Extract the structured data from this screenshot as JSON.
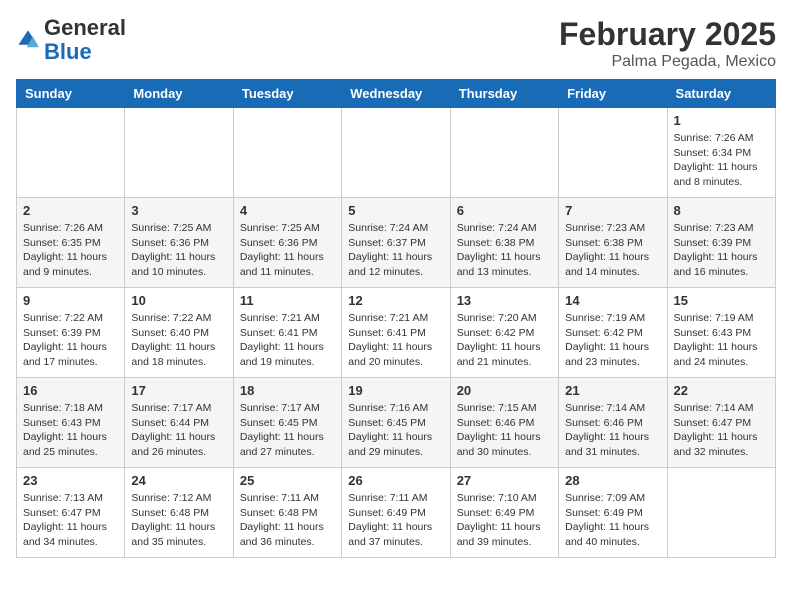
{
  "header": {
    "logo_general": "General",
    "logo_blue": "Blue",
    "month_title": "February 2025",
    "location": "Palma Pegada, Mexico"
  },
  "weekdays": [
    "Sunday",
    "Monday",
    "Tuesday",
    "Wednesday",
    "Thursday",
    "Friday",
    "Saturday"
  ],
  "weeks": [
    [
      {
        "day": "",
        "content": ""
      },
      {
        "day": "",
        "content": ""
      },
      {
        "day": "",
        "content": ""
      },
      {
        "day": "",
        "content": ""
      },
      {
        "day": "",
        "content": ""
      },
      {
        "day": "",
        "content": ""
      },
      {
        "day": "1",
        "content": "Sunrise: 7:26 AM\nSunset: 6:34 PM\nDaylight: 11 hours and 8 minutes."
      }
    ],
    [
      {
        "day": "2",
        "content": "Sunrise: 7:26 AM\nSunset: 6:35 PM\nDaylight: 11 hours and 9 minutes."
      },
      {
        "day": "3",
        "content": "Sunrise: 7:25 AM\nSunset: 6:36 PM\nDaylight: 11 hours and 10 minutes."
      },
      {
        "day": "4",
        "content": "Sunrise: 7:25 AM\nSunset: 6:36 PM\nDaylight: 11 hours and 11 minutes."
      },
      {
        "day": "5",
        "content": "Sunrise: 7:24 AM\nSunset: 6:37 PM\nDaylight: 11 hours and 12 minutes."
      },
      {
        "day": "6",
        "content": "Sunrise: 7:24 AM\nSunset: 6:38 PM\nDaylight: 11 hours and 13 minutes."
      },
      {
        "day": "7",
        "content": "Sunrise: 7:23 AM\nSunset: 6:38 PM\nDaylight: 11 hours and 14 minutes."
      },
      {
        "day": "8",
        "content": "Sunrise: 7:23 AM\nSunset: 6:39 PM\nDaylight: 11 hours and 16 minutes."
      }
    ],
    [
      {
        "day": "9",
        "content": "Sunrise: 7:22 AM\nSunset: 6:39 PM\nDaylight: 11 hours and 17 minutes."
      },
      {
        "day": "10",
        "content": "Sunrise: 7:22 AM\nSunset: 6:40 PM\nDaylight: 11 hours and 18 minutes."
      },
      {
        "day": "11",
        "content": "Sunrise: 7:21 AM\nSunset: 6:41 PM\nDaylight: 11 hours and 19 minutes."
      },
      {
        "day": "12",
        "content": "Sunrise: 7:21 AM\nSunset: 6:41 PM\nDaylight: 11 hours and 20 minutes."
      },
      {
        "day": "13",
        "content": "Sunrise: 7:20 AM\nSunset: 6:42 PM\nDaylight: 11 hours and 21 minutes."
      },
      {
        "day": "14",
        "content": "Sunrise: 7:19 AM\nSunset: 6:42 PM\nDaylight: 11 hours and 23 minutes."
      },
      {
        "day": "15",
        "content": "Sunrise: 7:19 AM\nSunset: 6:43 PM\nDaylight: 11 hours and 24 minutes."
      }
    ],
    [
      {
        "day": "16",
        "content": "Sunrise: 7:18 AM\nSunset: 6:43 PM\nDaylight: 11 hours and 25 minutes."
      },
      {
        "day": "17",
        "content": "Sunrise: 7:17 AM\nSunset: 6:44 PM\nDaylight: 11 hours and 26 minutes."
      },
      {
        "day": "18",
        "content": "Sunrise: 7:17 AM\nSunset: 6:45 PM\nDaylight: 11 hours and 27 minutes."
      },
      {
        "day": "19",
        "content": "Sunrise: 7:16 AM\nSunset: 6:45 PM\nDaylight: 11 hours and 29 minutes."
      },
      {
        "day": "20",
        "content": "Sunrise: 7:15 AM\nSunset: 6:46 PM\nDaylight: 11 hours and 30 minutes."
      },
      {
        "day": "21",
        "content": "Sunrise: 7:14 AM\nSunset: 6:46 PM\nDaylight: 11 hours and 31 minutes."
      },
      {
        "day": "22",
        "content": "Sunrise: 7:14 AM\nSunset: 6:47 PM\nDaylight: 11 hours and 32 minutes."
      }
    ],
    [
      {
        "day": "23",
        "content": "Sunrise: 7:13 AM\nSunset: 6:47 PM\nDaylight: 11 hours and 34 minutes."
      },
      {
        "day": "24",
        "content": "Sunrise: 7:12 AM\nSunset: 6:48 PM\nDaylight: 11 hours and 35 minutes."
      },
      {
        "day": "25",
        "content": "Sunrise: 7:11 AM\nSunset: 6:48 PM\nDaylight: 11 hours and 36 minutes."
      },
      {
        "day": "26",
        "content": "Sunrise: 7:11 AM\nSunset: 6:49 PM\nDaylight: 11 hours and 37 minutes."
      },
      {
        "day": "27",
        "content": "Sunrise: 7:10 AM\nSunset: 6:49 PM\nDaylight: 11 hours and 39 minutes."
      },
      {
        "day": "28",
        "content": "Sunrise: 7:09 AM\nSunset: 6:49 PM\nDaylight: 11 hours and 40 minutes."
      },
      {
        "day": "",
        "content": ""
      }
    ]
  ]
}
